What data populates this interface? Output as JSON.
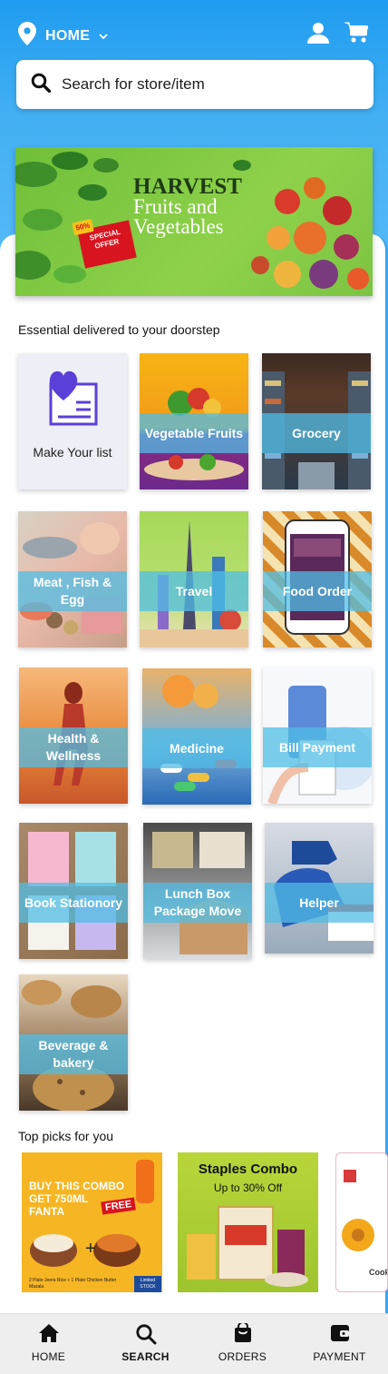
{
  "header": {
    "location_label": "HOME",
    "colors": {
      "gradient_top": "#1f9cf0",
      "gradient_bottom": "#55b9f6"
    }
  },
  "search": {
    "placeholder": "Search for store/item"
  },
  "banner": {
    "title_line1": "HARVEST",
    "title_line2": "Fruits and Vegetables",
    "badge_percent": "50%",
    "badge_text": "SPECIAL OFFER"
  },
  "sections": {
    "essential_title": "Essential delivered to your doorstep",
    "top_picks_title": "Top picks for you"
  },
  "categories": [
    {
      "label": "Make Your list",
      "icon": "list-heart-icon"
    },
    {
      "label": "Vegetable Fruits"
    },
    {
      "label": "Grocery"
    },
    {
      "label": "Meat , Fish & Egg"
    },
    {
      "label": "Travel"
    },
    {
      "label": "Food Order"
    },
    {
      "label": "Health & Wellness"
    },
    {
      "label": "Medicine"
    },
    {
      "label": "Bill Payment"
    },
    {
      "label": "Book Stationory"
    },
    {
      "label": "Lunch Box Package Move"
    },
    {
      "label": "Helper"
    },
    {
      "label": "Beverage & bakery"
    }
  ],
  "top_picks": [
    {
      "line1": "BUY THIS COMBO",
      "line2": "GET 750ML",
      "line3": "FANTA",
      "free": "FREE",
      "footer": "2 Plate Jeera Rice + 1 Plate Chicken Butter Masala",
      "stock": "Limited STOCK"
    },
    {
      "title": "Staples Combo",
      "subtitle": "Up to 30% Off"
    },
    {
      "caption": "Cooki"
    }
  ],
  "bottom_nav": [
    {
      "label": "HOME",
      "icon": "home-icon"
    },
    {
      "label": "SEARCH",
      "icon": "search-icon",
      "active": true
    },
    {
      "label": "ORDERS",
      "icon": "orders-bag-icon"
    },
    {
      "label": "PAYMENT",
      "icon": "wallet-icon"
    }
  ]
}
